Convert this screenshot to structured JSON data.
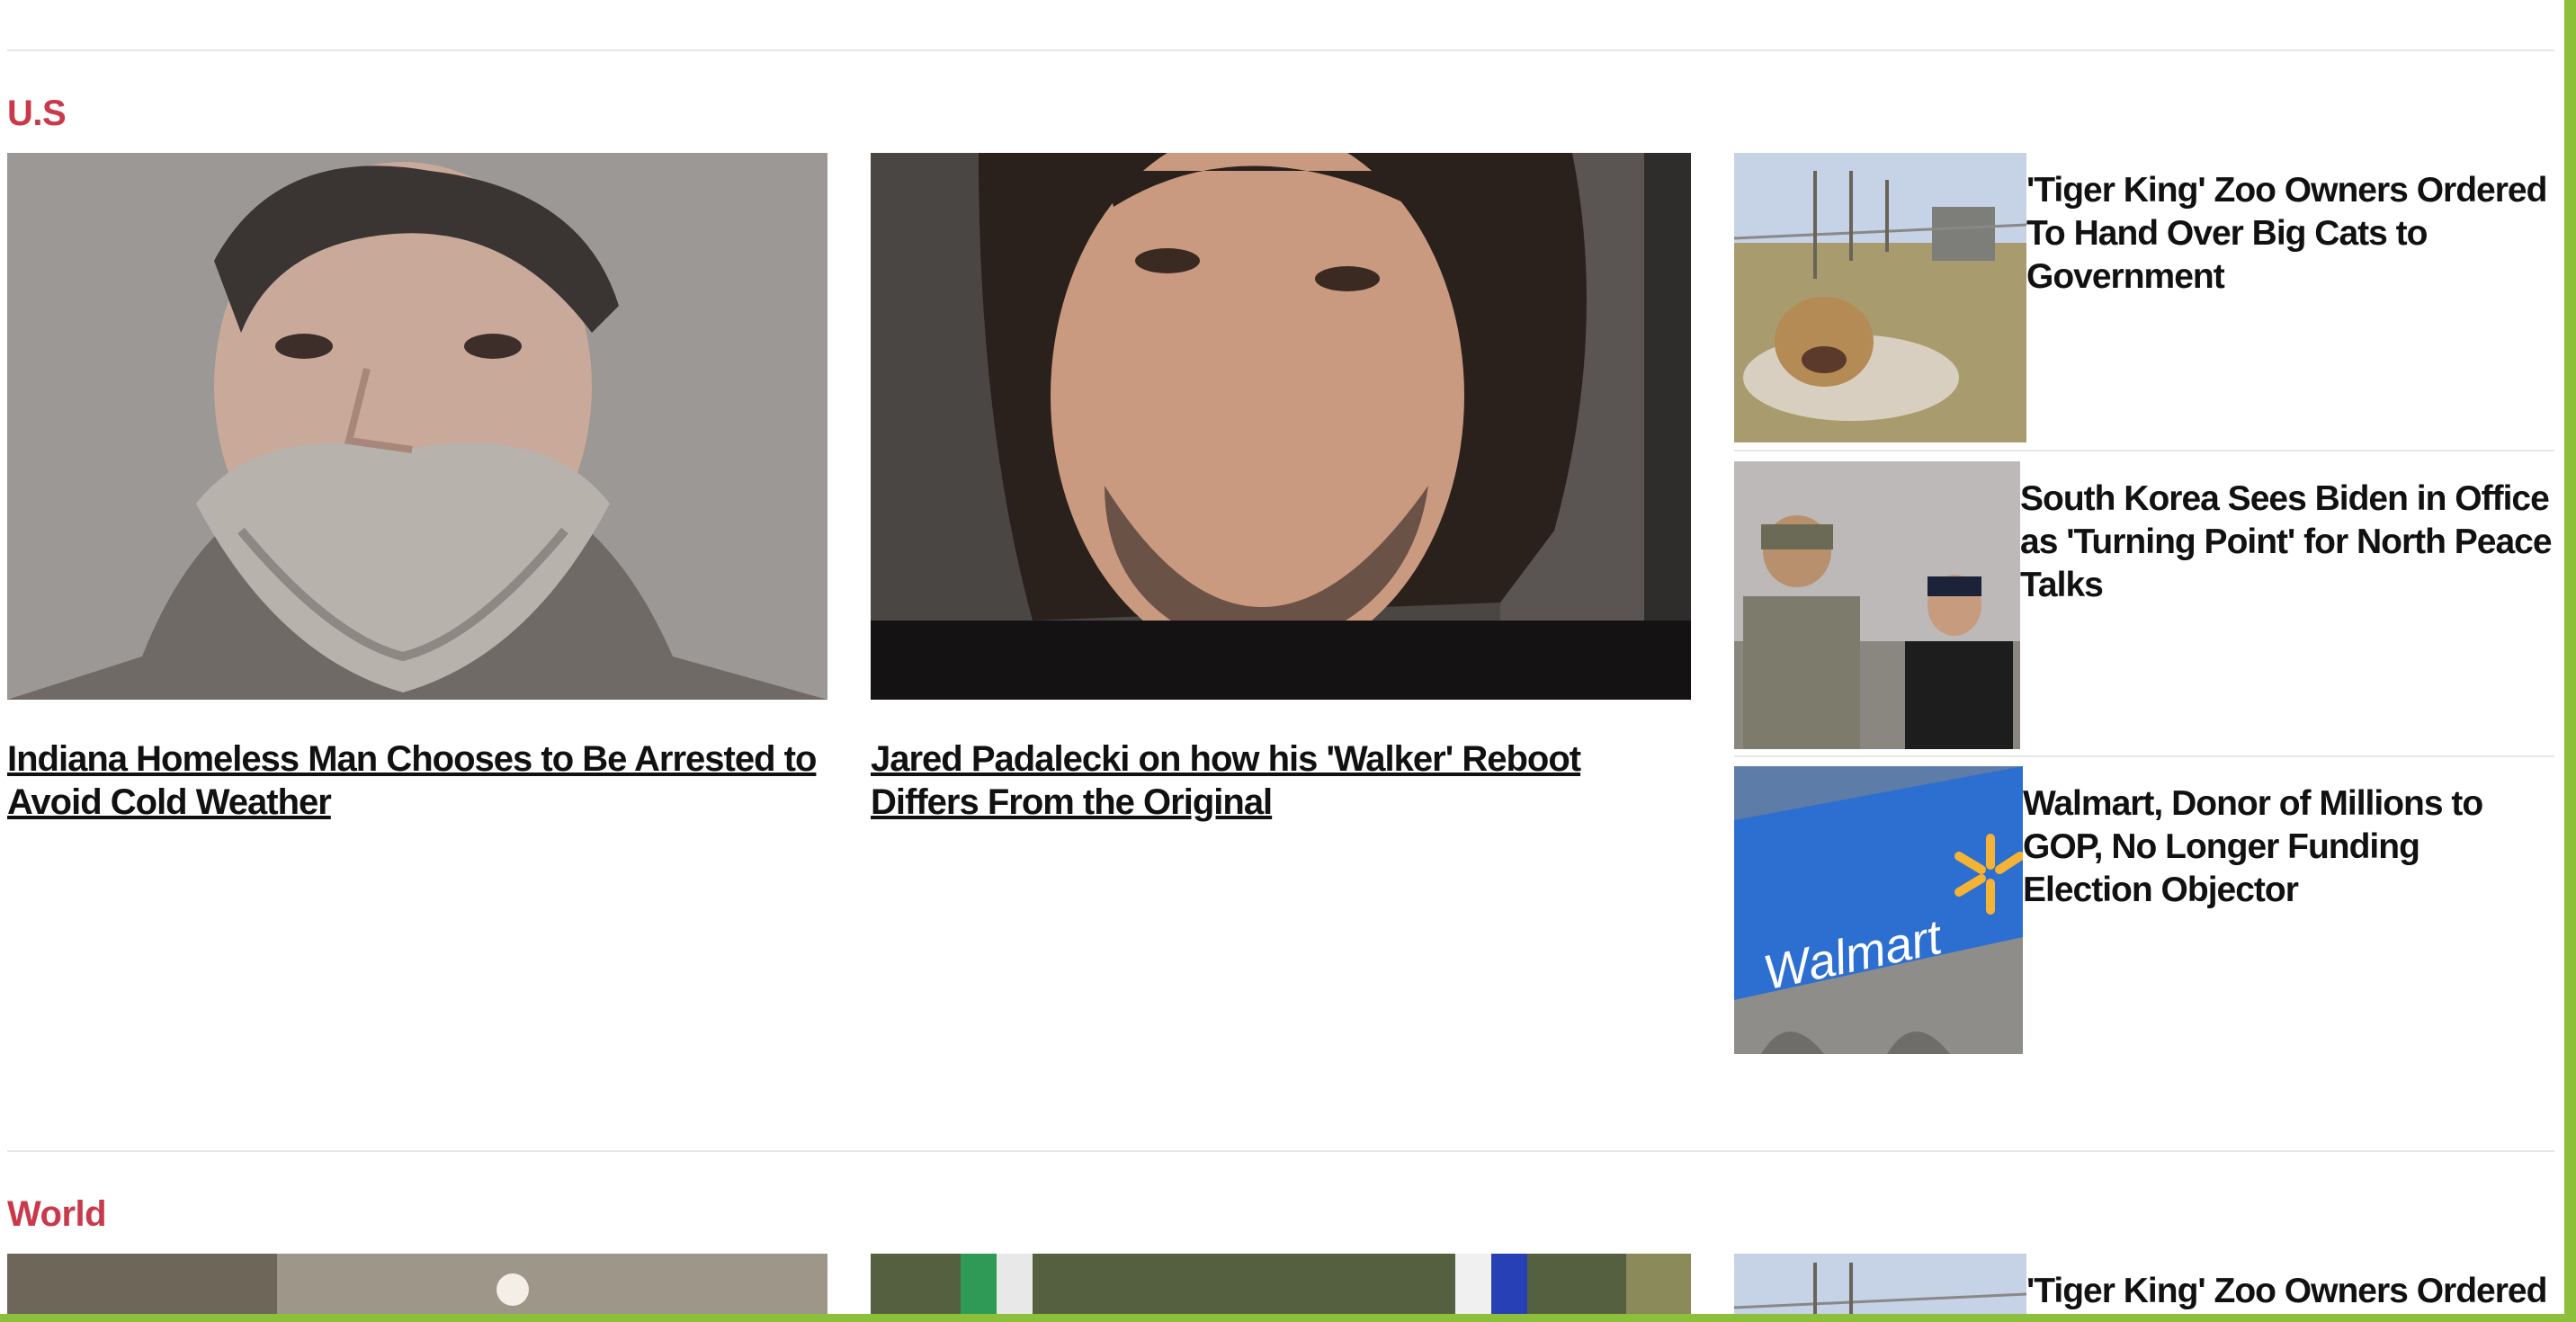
{
  "sections": [
    {
      "title": "U.S",
      "features": [
        {
          "headline": "Indiana Homeless Man Chooses to Be Arrested to Avoid Cold Weather",
          "image": "bearded-man-mugshot"
        },
        {
          "headline": "Jared Padalecki on how his 'Walker' Reboot Differs From the Original",
          "image": "man-portrait"
        }
      ],
      "side": [
        {
          "title": "'Tiger King' Zoo Owners Ordered To Hand Over Big Cats to Government",
          "image": "tiger-in-field"
        },
        {
          "title": "South Korea Sees Biden in Office as 'Turning Point' for North Peace Talks",
          "image": "officials-at-border"
        },
        {
          "title": "Walmart, Donor of Millions to GOP, No Longer Funding Election Objector",
          "image": "walmart-storefront",
          "sign_text": "Walmart"
        }
      ]
    },
    {
      "title": "World",
      "side": [
        {
          "title": "'Tiger King' Zoo Owners Ordered",
          "image": "tiger-in-field"
        }
      ]
    }
  ],
  "colors": {
    "section_title": "#c9394a",
    "frame": "#8cbf3a",
    "walmart_blue": "#2d6fd1",
    "walmart_spark": "#f5b335"
  }
}
